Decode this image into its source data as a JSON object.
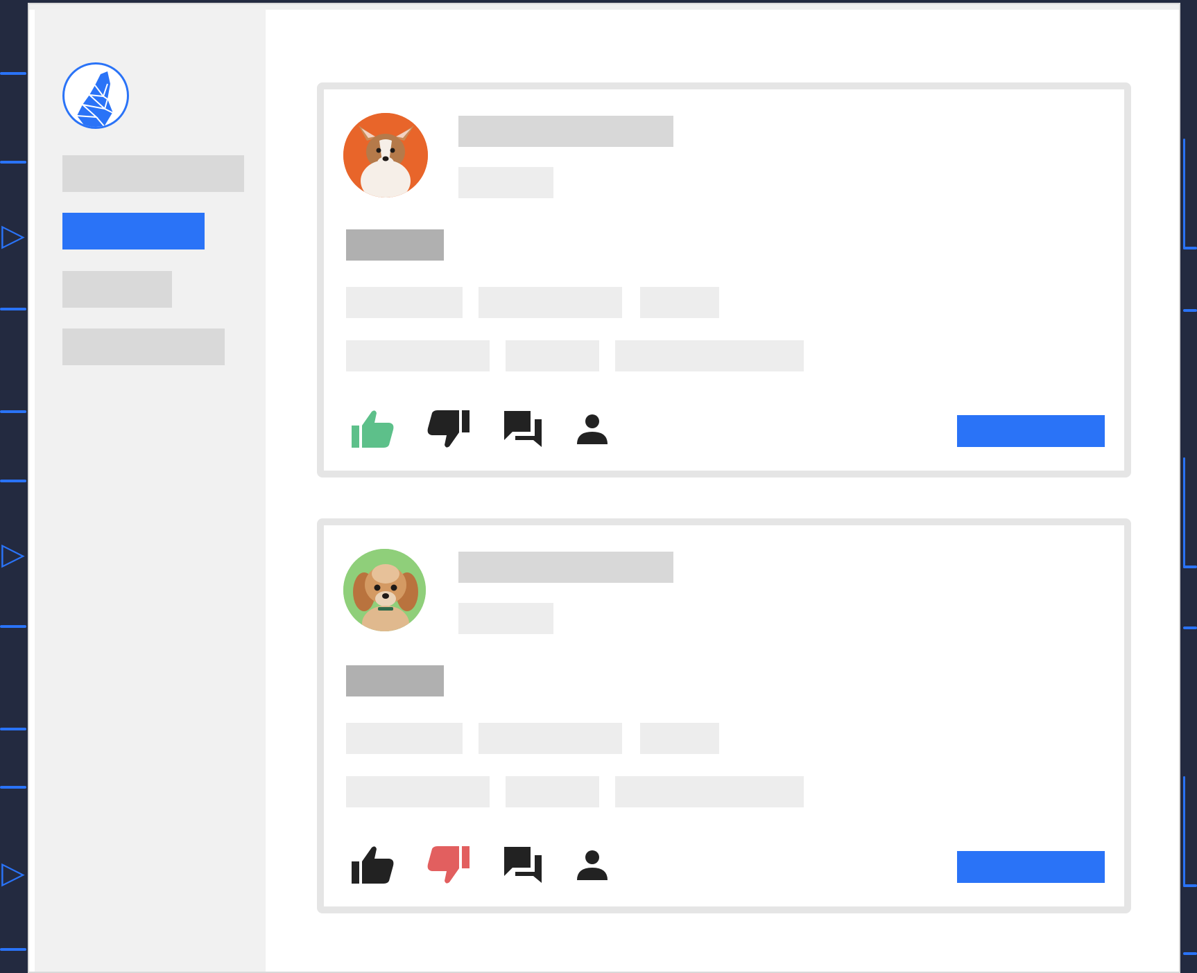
{
  "app": {
    "logo": "logo-icon",
    "accent_color": "#2a73f7",
    "like_active_color": "#5dc08a",
    "dislike_active_color": "#e25f5f",
    "icon_color": "#222222"
  },
  "sidebar": {
    "items": [
      {
        "state": "default"
      },
      {
        "state": "active"
      },
      {
        "state": "default"
      },
      {
        "state": "default"
      }
    ]
  },
  "posts": [
    {
      "avatar": "corgi-avatar",
      "avatar_bg": "#e8652a",
      "reactions": {
        "like": "active",
        "dislike": "inactive"
      },
      "icons": [
        "thumbs-up-icon",
        "thumbs-down-icon",
        "comments-icon",
        "person-icon"
      ]
    },
    {
      "avatar": "terrier-avatar",
      "avatar_bg": "#8fcf7a",
      "reactions": {
        "like": "inactive",
        "dislike": "active"
      },
      "icons": [
        "thumbs-up-icon",
        "thumbs-down-icon",
        "comments-icon",
        "person-icon"
      ]
    }
  ]
}
